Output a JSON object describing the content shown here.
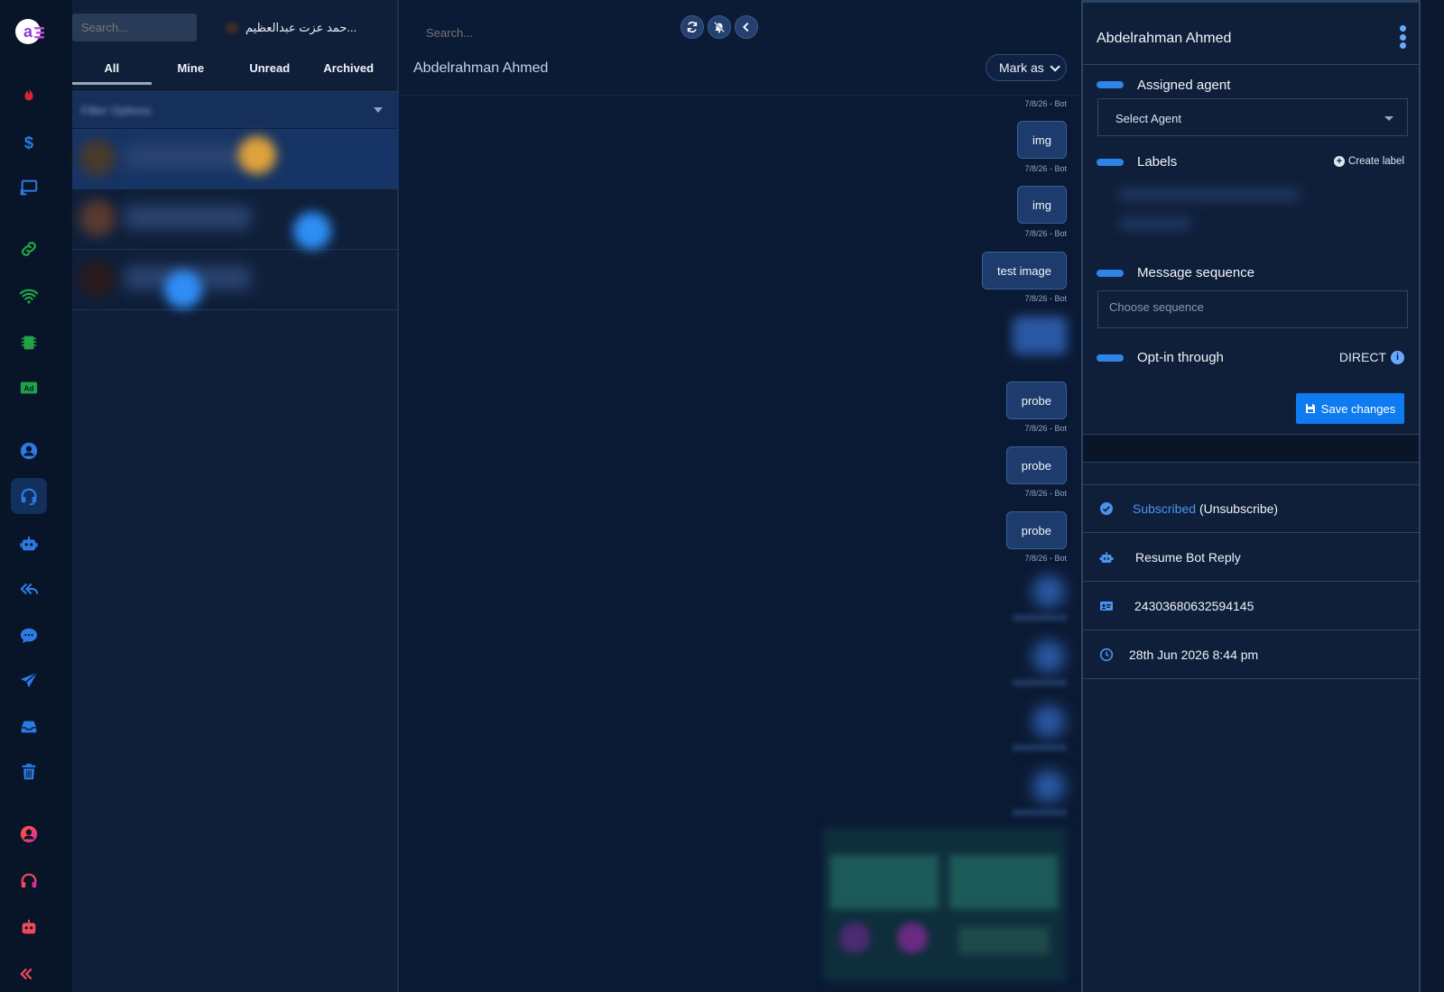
{
  "colors": {
    "accent": "#0e7cf0",
    "toggle": "#2f84e8",
    "link": "#4b93f0",
    "panel": "#0f1f3a",
    "chat_bg": "#0b1a34",
    "rail_bg": "#081428"
  },
  "rail": {
    "icons": [
      "app-logo-icon",
      "fire-icon",
      "dollar-icon",
      "screen-share-icon",
      "link-icon",
      "wifi-icon",
      "chip-icon",
      "ad-icon",
      "user-circle-icon",
      "headset-icon",
      "robot-icon",
      "reply-all-icon",
      "chat-bubble-icon",
      "send-icon",
      "inbox-icon",
      "trash-icon",
      "user-circle-icon",
      "headset-icon",
      "robot-icon",
      "reply-all-icon"
    ],
    "ad_text": "Ad"
  },
  "list": {
    "search_placeholder": "Search...",
    "top_contact_name": "حمد عزت عبدالعظيم...",
    "tabs": [
      {
        "label": "All",
        "active": true
      },
      {
        "label": "Mine",
        "active": false
      },
      {
        "label": "Unread",
        "active": false
      },
      {
        "label": "Archived",
        "active": false
      }
    ],
    "filter_text": "Filter Options"
  },
  "chat": {
    "search_placeholder": "Search...",
    "tools": [
      "refresh-icon",
      "bell-off-icon",
      "collapse-icon"
    ],
    "title": "Abdelrahman Ahmed",
    "mark_as": "Mark as",
    "stamp": "7/8/26 - Bot",
    "messages": [
      {
        "text": "img"
      },
      {
        "text": "img"
      },
      {
        "text": "test image"
      },
      {
        "text": "probe"
      },
      {
        "text": "probe"
      },
      {
        "text": "probe"
      }
    ]
  },
  "side": {
    "name": "Abdelrahman Ahmed",
    "assigned_agent_label": "Assigned agent",
    "agent_select": "Select Agent",
    "labels_label": "Labels",
    "create_label": "Create label",
    "message_sequence_label": "Message sequence",
    "sequence_placeholder": "Choose sequence",
    "optin_label": "Opt-in through",
    "optin_value": "DIRECT",
    "save": "Save changes",
    "subscribed": "Subscribed",
    "unsubscribe": "(Unsubscribe)",
    "resume_bot": "Resume Bot Reply",
    "subscriber_id": "24303680632594145",
    "subscribed_at": "28th Jun 2026 8:44 pm"
  }
}
